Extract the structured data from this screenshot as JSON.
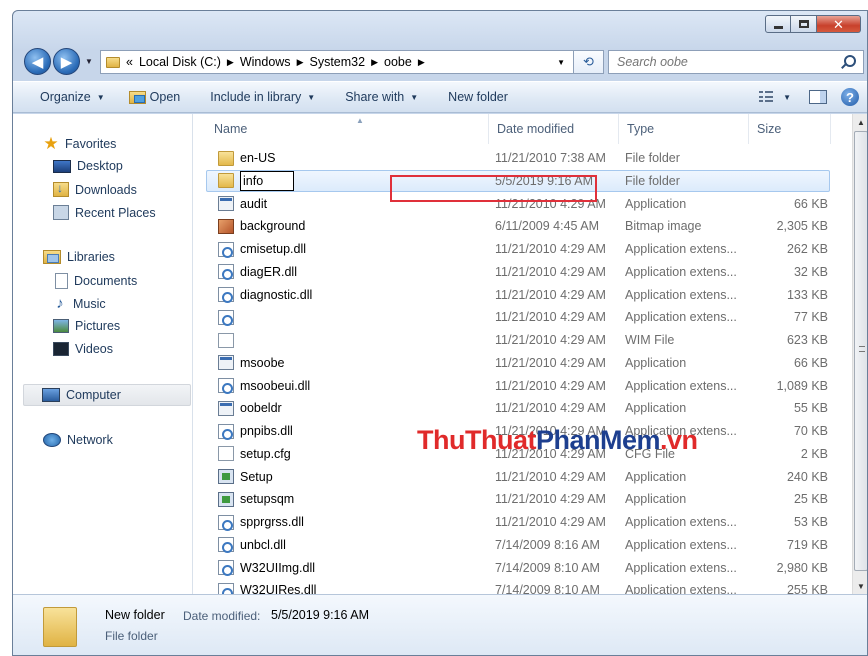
{
  "address": {
    "overflow": "«",
    "crumbs": [
      "Local Disk (C:)",
      "Windows",
      "System32",
      "oobe"
    ],
    "refresh_glyph": "⟲"
  },
  "search": {
    "placeholder": "Search oobe"
  },
  "toolbar": {
    "organize": "Organize",
    "open": "Open",
    "include_in_library": "Include in library",
    "share_with": "Share with",
    "new_folder": "New folder"
  },
  "nav": {
    "favorites": "Favorites",
    "desktop": "Desktop",
    "downloads": "Downloads",
    "recent_places": "Recent Places",
    "libraries": "Libraries",
    "documents": "Documents",
    "music": "Music",
    "pictures": "Pictures",
    "videos": "Videos",
    "computer": "Computer",
    "network": "Network"
  },
  "columns": {
    "name": "Name",
    "date": "Date modified",
    "type": "Type",
    "size": "Size"
  },
  "files": [
    {
      "name": "en-US",
      "date": "11/21/2010 7:38 AM",
      "type": "File folder",
      "size": "",
      "icon": "folder"
    },
    {
      "name": "info",
      "date": "5/5/2019 9:16 AM",
      "type": "File folder",
      "size": "",
      "icon": "folder",
      "renaming": true
    },
    {
      "name": "audit",
      "date": "11/21/2010 4:29 AM",
      "type": "Application",
      "size": "66 KB",
      "icon": "app"
    },
    {
      "name": "background",
      "date": "6/11/2009 4:45 AM",
      "type": "Bitmap image",
      "size": "2,305 KB",
      "icon": "bitmap"
    },
    {
      "name": "cmisetup.dll",
      "date": "11/21/2010 4:29 AM",
      "type": "Application extens...",
      "size": "262 KB",
      "icon": "dll"
    },
    {
      "name": "diagER.dll",
      "date": "11/21/2010 4:29 AM",
      "type": "Application extens...",
      "size": "32 KB",
      "icon": "dll"
    },
    {
      "name": "diagnostic.dll",
      "date": "11/21/2010 4:29 AM",
      "type": "Application extens...",
      "size": "133 KB",
      "icon": "dll"
    },
    {
      "name": "",
      "date": "11/21/2010 4:29 AM",
      "type": "Application extens...",
      "size": "77 KB",
      "icon": "dll"
    },
    {
      "name": "",
      "date": "11/21/2010 4:29 AM",
      "type": "WIM File",
      "size": "623 KB",
      "icon": "txt"
    },
    {
      "name": "msoobe",
      "date": "11/21/2010 4:29 AM",
      "type": "Application",
      "size": "66 KB",
      "icon": "app"
    },
    {
      "name": "msoobeui.dll",
      "date": "11/21/2010 4:29 AM",
      "type": "Application extens...",
      "size": "1,089 KB",
      "icon": "dll"
    },
    {
      "name": "oobeldr",
      "date": "11/21/2010 4:29 AM",
      "type": "Application",
      "size": "55 KB",
      "icon": "app"
    },
    {
      "name": "pnpibs.dll",
      "date": "11/21/2010 4:29 AM",
      "type": "Application extens...",
      "size": "70 KB",
      "icon": "dll"
    },
    {
      "name": "setup.cfg",
      "date": "11/21/2010 4:29 AM",
      "type": "CFG File",
      "size": "2 KB",
      "icon": "txt"
    },
    {
      "name": "Setup",
      "date": "11/21/2010 4:29 AM",
      "type": "Application",
      "size": "240 KB",
      "icon": "app2"
    },
    {
      "name": "setupsqm",
      "date": "11/21/2010 4:29 AM",
      "type": "Application",
      "size": "25 KB",
      "icon": "app2"
    },
    {
      "name": "spprgrss.dll",
      "date": "11/21/2010 4:29 AM",
      "type": "Application extens...",
      "size": "53 KB",
      "icon": "dll"
    },
    {
      "name": "unbcl.dll",
      "date": "7/14/2009 8:16 AM",
      "type": "Application extens...",
      "size": "719 KB",
      "icon": "dll"
    },
    {
      "name": "W32UIImg.dll",
      "date": "7/14/2009 8:10 AM",
      "type": "Application extens...",
      "size": "2,980 KB",
      "icon": "dll"
    },
    {
      "name": "W32UIRes.dll",
      "date": "7/14/2009 8:10 AM",
      "type": "Application extens...",
      "size": "255 KB",
      "icon": "dll"
    }
  ],
  "watermark": {
    "part1": "ThuThuat",
    "part2": "PhanMem",
    "part3": ".vn"
  },
  "details": {
    "name": "New folder",
    "date_label": "Date modified:",
    "date_value": "5/5/2019 9:16 AM",
    "type": "File folder"
  },
  "colors": {
    "selection_border": "#a6c8ee",
    "highlight_frame": "#e0303a",
    "watermark_red": "#e02a2a",
    "watermark_blue": "#1d3f8f"
  }
}
